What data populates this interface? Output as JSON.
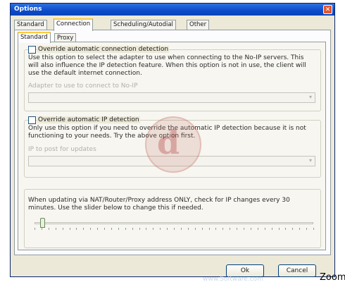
{
  "window": {
    "title": "Options"
  },
  "tabs": [
    "Standard",
    "Connection",
    "Scheduling/Autodial",
    "Other"
  ],
  "subtabs": [
    "Standard",
    "Proxy"
  ],
  "adapter_group": {
    "checkbox_label": "Override automatic connection detection",
    "desc1": "Use this option to select the adapter to use when connecting to the No-IP servers.  This",
    "desc2": "will also influence the IP detection feature.  When this option is not in use, the client will",
    "desc3": "use the default internet connection.",
    "combo_label": "Adapter to use to connect to No-IP"
  },
  "ip_group": {
    "checkbox_label": "Override automatic IP detection",
    "desc1": "Only use this option if you need to override the automatic IP detection because it is not",
    "desc2": "functioning to your needs.  Try the above option first.",
    "combo_label": "IP to post for updates"
  },
  "nat_group": {
    "desc1": "When updating via NAT/Router/Proxy address ONLY, check for IP changes every 30",
    "desc2": "minutes.  Use the slider below to change this if needed.",
    "slider_value": 0.02
  },
  "buttons": {
    "ok": "Ok",
    "cancel": "Cancel"
  },
  "zoom_label": "Zoom",
  "watermark": "www.Software.com"
}
